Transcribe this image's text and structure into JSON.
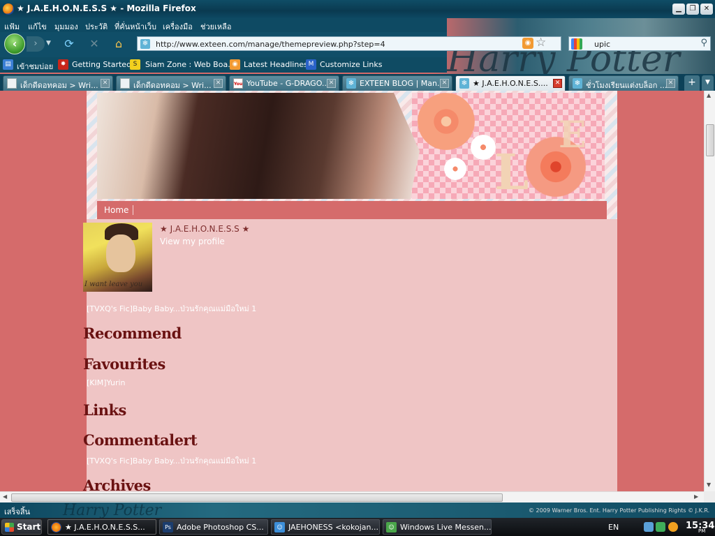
{
  "window": {
    "title": "★ J.A.E.H.O.N.E.S.S ★ - Mozilla Firefox",
    "controls": {
      "minimize": "▁",
      "restore": "❐",
      "close": "✕"
    }
  },
  "menu": [
    "แฟ้ม",
    "แก้ไข",
    "มุมมอง",
    "ประวัติ",
    "ที่คั่นหน้าเว็บ",
    "เครื่องมือ",
    "ช่วยเหลือ"
  ],
  "nav": {
    "back": "‹",
    "forward": "›",
    "url": "http://www.exteen.com/manage/themepreview.php?step=4",
    "search_query": "upic",
    "icons": [
      "back-icon",
      "forward-icon",
      "reload-icon",
      "stop-icon",
      "home-icon",
      "rss-icon",
      "bookmark-star-icon",
      "google-icon",
      "search-icon"
    ]
  },
  "bookmarks": [
    "เข้าชมบ่อย",
    "Getting Started",
    "Siam Zone : Web Boa...",
    "Latest Headlines",
    "Customize Links"
  ],
  "tabs": [
    {
      "label": "เด็กดีดอทคอม > Wri...",
      "active": false
    },
    {
      "label": "เด็กดีดอทคอม > Wri...",
      "active": false
    },
    {
      "label": "YouTube - G-DRAGO...",
      "active": false
    },
    {
      "label": "EXTEEN BLOG | Man...",
      "active": false
    },
    {
      "label": "★ J.A.E.H.O.N.E.S....",
      "active": true
    },
    {
      "label": "ชั่วโมงเรียนแต่งบล็อก ...",
      "active": false
    }
  ],
  "page": {
    "nav_home": "Home",
    "blog_name": "★ J.A.E.H.O.N.E.S.S ★",
    "view_profile": "View my profile",
    "avatar_caption": "I want leave you",
    "recent_entry": "[TVXQ's Fic]Baby Baby...ป่วนรักคุณแม่มือใหม่ 1",
    "sections": {
      "recommend": "Recommend",
      "favourites": "Favourites",
      "favourite_item": "[KIM]Yurin",
      "links": "Links",
      "commentalert": "Commentalert",
      "comment_item": "[TVXQ's Fic]Baby Baby...ป่วนรักคุณแม่มือใหม่ 1",
      "archives": "Archives"
    }
  },
  "status": {
    "text": "เสร็จสิ้น",
    "copyright": "© 2009 Warner Bros. Ent. Harry Potter Publishing Rights © J.K.R."
  },
  "taskbar": {
    "start": "Start",
    "tasks": [
      {
        "label": "★ J.A.E.H.O.N.E.S.S...",
        "active": true
      },
      {
        "label": "Adobe Photoshop CS...",
        "active": false
      },
      {
        "label": "JAEHONESS <kokojan...",
        "active": false
      },
      {
        "label": "Windows Live Messen...",
        "active": false
      }
    ],
    "lang": "EN",
    "time": "15:34",
    "ampm": "PM"
  },
  "colors": {
    "page_bg": "#d56b6b",
    "content_bg": "#efc5c5",
    "heading": "#6a1212",
    "titlebar": "#0f4d66"
  }
}
